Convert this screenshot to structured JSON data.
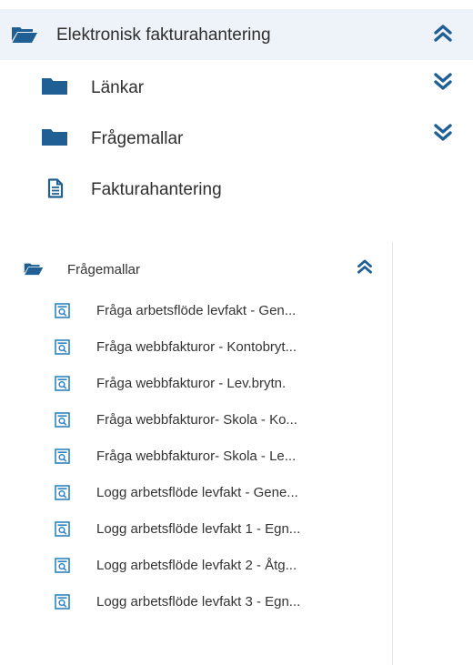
{
  "colors": {
    "folder": "#1f5f93",
    "chevron": "#1f5f93",
    "doc_icon": "#1f5f93",
    "query_icon": "#2d83c1",
    "active_row_bg": "#edf3f8"
  },
  "top_tree": [
    {
      "label": "Elektronisk fakturahantering",
      "icon": "folder-open-icon",
      "toggle": "chevron-double-up-icon"
    },
    {
      "label": "Länkar",
      "icon": "folder-icon",
      "toggle": "chevron-double-down-icon"
    },
    {
      "label": "Frågemallar",
      "icon": "folder-icon",
      "toggle": "chevron-double-down-icon"
    },
    {
      "label": "Fakturahantering",
      "icon": "document-icon"
    }
  ],
  "panel": {
    "title": "Frågemallar",
    "icon": "folder-open-icon",
    "toggle": "chevron-double-up-icon",
    "items": [
      {
        "label": "Fråga arbetsflöde levfakt - Gen..."
      },
      {
        "label": "Fråga webbfakturor - Kontobryt..."
      },
      {
        "label": "Fråga webbfakturor - Lev.brytn."
      },
      {
        "label": "Fråga webbfakturor- Skola - Ko..."
      },
      {
        "label": "Fråga webbfakturor- Skola - Le..."
      },
      {
        "label": "Logg arbetsflöde levfakt - Gene..."
      },
      {
        "label": "Logg arbetsflöde levfakt 1 - Egn..."
      },
      {
        "label": "Logg arbetsflöde levfakt 2 - Åtg..."
      },
      {
        "label": "Logg arbetsflöde levfakt 3 - Egn..."
      }
    ]
  }
}
